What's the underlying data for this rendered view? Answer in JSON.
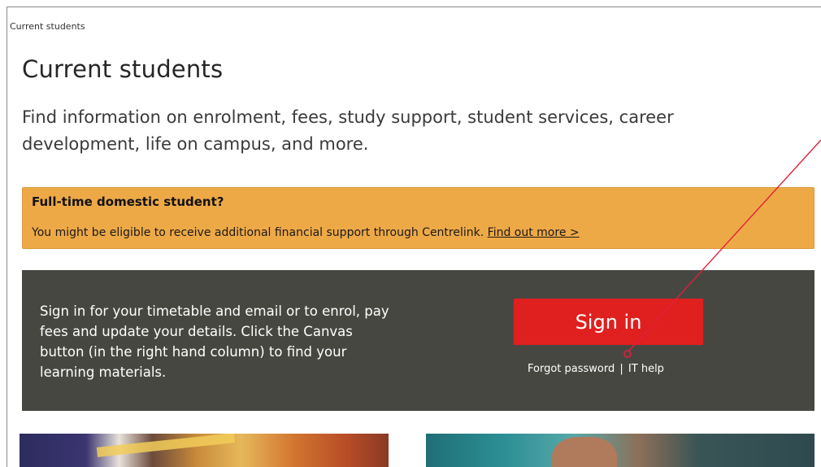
{
  "breadcrumb": "Current students",
  "page": {
    "title": "Current students",
    "intro": "Find information on enrolment, fees, study support, student services, career development, life on campus, and more."
  },
  "alert": {
    "title": "Full-time domestic student?",
    "body": "You might be eligible to receive additional financial support through Centrelink.",
    "link_label": "Find out more >"
  },
  "signin": {
    "description": "Sign in for your timetable and email or to enrol, pay fees and update your details. Click the Canvas button (in the right hand column) to find your learning materials.",
    "button_label": "Sign in",
    "forgot_label": "Forgot password",
    "separator": "|",
    "help_label": "IT help"
  },
  "colors": {
    "alert_bg": "#eea947",
    "panel_bg": "#474742",
    "signin_button": "#e0201f",
    "annotation": "#e0203a"
  },
  "annotation": {
    "icon": "pointer-circle-icon"
  }
}
